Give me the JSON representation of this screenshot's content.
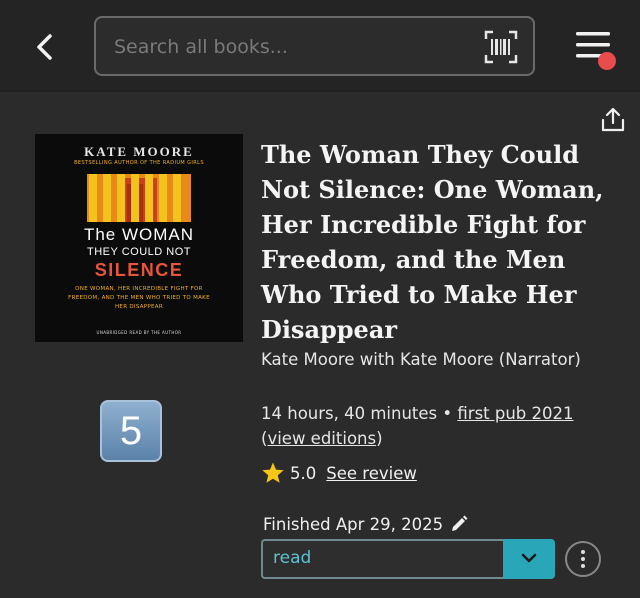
{
  "header": {
    "search_placeholder": "Search all books..."
  },
  "book": {
    "cover": {
      "author": "KATE MOORE",
      "tagline": "BESTSELLING AUTHOR OF THE RADIUM GIRLS",
      "title_line1": "The WOMAN",
      "title_line2": "THEY COULD NOT",
      "title_line3": "SILENCE",
      "subtitle": "ONE WOMAN, HER INCREDIBLE FIGHT FOR FREEDOM, AND THE MEN WHO TRIED TO MAKE HER DISAPPEAR",
      "footer": "UNABRIDGED   READ BY THE AUTHOR"
    },
    "badge": "5",
    "title": "The Woman They Could Not Silence: One Woman, Her Incredible Fight for Freedom, and the Men Who Tried to Make Her Disappear",
    "authors": "Kate Moore with Kate Moore (Narrator)",
    "duration": "14 hours, 40 minutes",
    "separator": " • ",
    "first_pub": "first pub 2021",
    "editions_open": "(",
    "editions_link": "view editions",
    "editions_close": ")",
    "rating": "5.0",
    "see_review": "See review",
    "finished": "Finished Apr 29, 2025",
    "status": "read"
  },
  "colors": {
    "background": "#2b2b2b",
    "header": "#242424",
    "accent": "#2aa6b9",
    "notification": "#e84c4c",
    "star": "#f5c518"
  }
}
